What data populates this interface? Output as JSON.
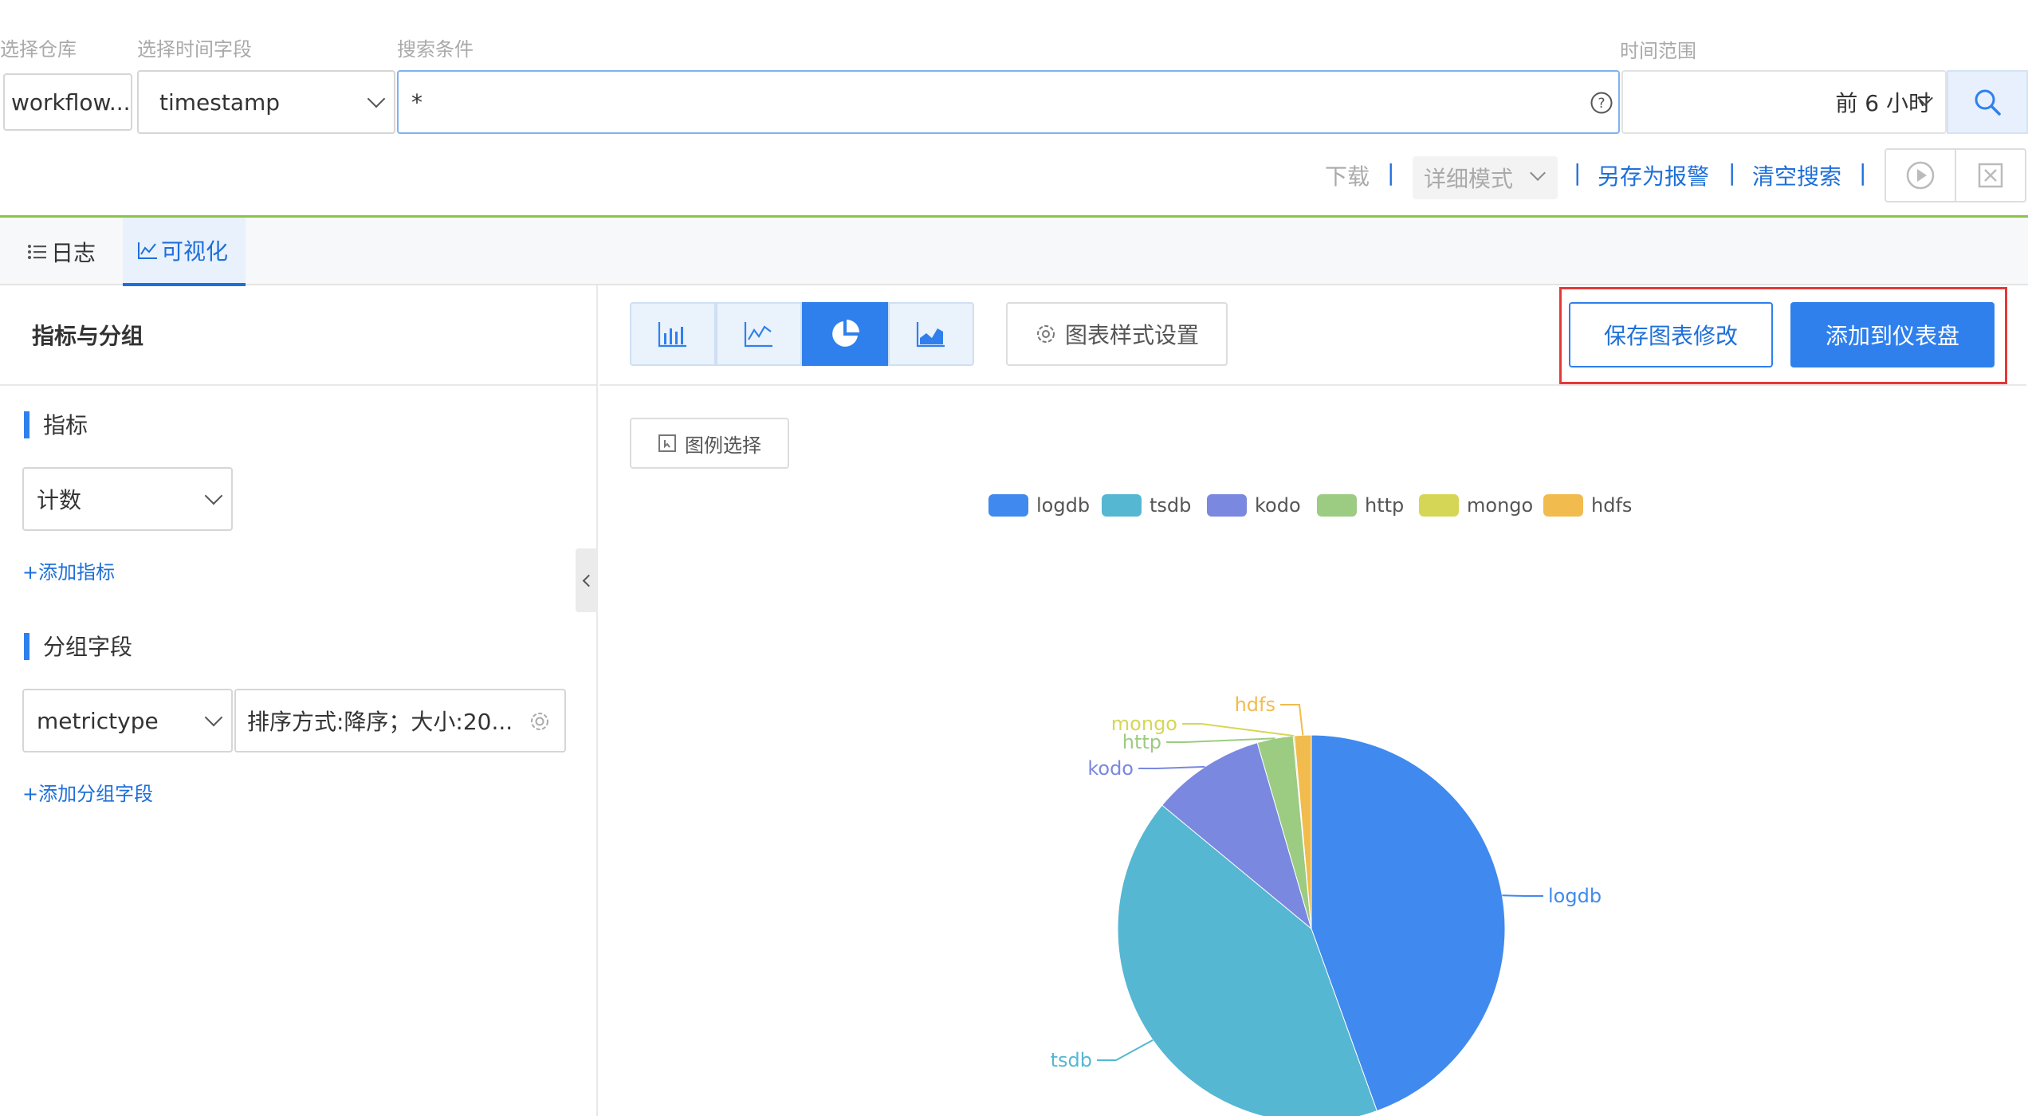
{
  "header": {
    "repo_label": "选择仓库",
    "repo_value": "workflow...",
    "timefield_label": "选择时间字段",
    "timefield_value": "timestamp",
    "search_label": "搜索条件",
    "search_value": "*",
    "range_label": "时间范围",
    "range_value": "前 6 小时"
  },
  "toolbar": {
    "download": "下载",
    "mode": "详细模式",
    "save_alert": "另存为报警",
    "clear_search": "清空搜索",
    "separator": "|"
  },
  "tabs": [
    {
      "label": "日志",
      "active": false
    },
    {
      "label": "可视化",
      "active": true
    }
  ],
  "left_panel": {
    "title": "指标与分组",
    "metrics_title": "指标",
    "metric_value": "计数",
    "add_metric": "+添加指标",
    "group_title": "分组字段",
    "group_field": "metrictype",
    "group_sort": "排序方式:降序；大小:20...",
    "add_group": "+添加分组字段"
  },
  "chart_toolbar": {
    "style_settings": "图表样式设置",
    "save_chart": "保存图表修改",
    "add_dashboard": "添加到仪表盘",
    "legend_select": "图例选择",
    "chart_types": [
      "bar-chart",
      "line-chart",
      "pie-chart",
      "area-chart"
    ],
    "active_type": "pie-chart"
  },
  "colors": {
    "accent": "#2f80ed",
    "highlight_border": "#e53935",
    "tab_top_border": "#8bc34a"
  },
  "chart_data": {
    "type": "pie",
    "legend_position": "top-center",
    "labels": [
      "logdb",
      "tsdb",
      "kodo",
      "http",
      "mongo",
      "hdfs"
    ],
    "values": [
      44.5,
      41.5,
      9.5,
      3.0,
      0.1,
      1.4
    ],
    "colors": [
      "#4089ee",
      "#55b7d2",
      "#7a88e0",
      "#9ccb82",
      "#d6d656",
      "#f1bb4e"
    ]
  }
}
